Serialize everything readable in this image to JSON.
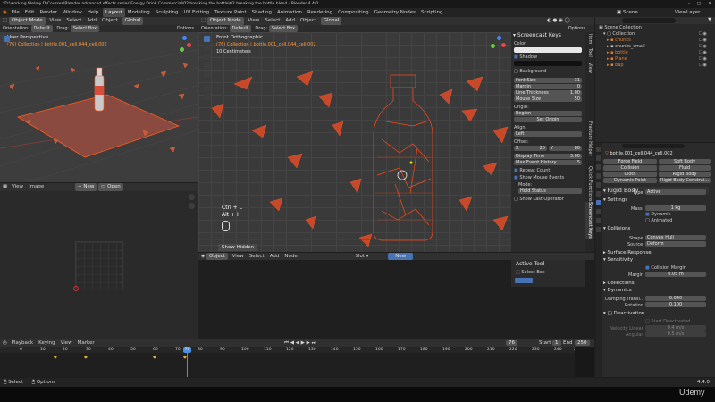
{
  "window": {
    "title": "*D:\\working file\\my D\\Courses\\Blender advanced effects series\\Energy Drink Commercial\\02 breaking the bottle\\02 breaking the bottle.blend - Blender 4.4.0",
    "version": "4.4.0",
    "watermark": "Udemy"
  },
  "topbar": {
    "menus": [
      "File",
      "Edit",
      "Render",
      "Window",
      "Help"
    ],
    "workspaces": [
      "Layout",
      "Modeling",
      "Sculpting",
      "UV Editing",
      "Texture Paint",
      "Shading",
      "Animation",
      "Rendering",
      "Compositing",
      "Geometry Nodes",
      "Scripting"
    ],
    "active_workspace": "Layout",
    "scene": "Scene",
    "view_layer": "ViewLayer"
  },
  "left_viewport": {
    "mode": "Object Mode",
    "menus": [
      "View",
      "Select",
      "Add",
      "Object"
    ],
    "orientation_label": "Orientation:",
    "orientation": "Default",
    "drag_label": "Drag:",
    "drag": "Select Box",
    "options": "Options",
    "transform": "Global",
    "view_name": "User Perspective",
    "collection_line": "(76) Collection | bottle.001_cell.044_cell.002"
  },
  "main_viewport": {
    "mode": "Object Mode",
    "menus": [
      "View",
      "Select",
      "Add",
      "Object"
    ],
    "orientation_label": "Orientation:",
    "orientation": "Default",
    "drag_label": "Drag:",
    "drag": "Select Box",
    "options": "Options",
    "transform": "Global",
    "view_name": "Front Orthographic",
    "collection_line": "(76) Collection | bottle.001_cell.044_cell.002",
    "scale_label": "10 Centimeters",
    "keys_overlay": [
      "Ctrl + L",
      "Alt + H"
    ],
    "last_op": "Show Hidden"
  },
  "screencast_panel": {
    "title": "Screencast Keys",
    "color_label": "Color:",
    "shadow_label": "Shadow",
    "background_label": "Background",
    "font_size_label": "Font Size",
    "font_size": "31",
    "margin_label": "Margin",
    "margin": "0",
    "line_thickness_label": "Line Thickness",
    "line_thickness": "1.00",
    "mouse_size_label": "Mouse Size",
    "mouse_size": "50",
    "origin_label": "Origin:",
    "origin": "Region",
    "set_origin": "Set Origin",
    "align_label": "Align:",
    "align": "Left",
    "offset_label": "Offset:",
    "offset_x_label": "X",
    "offset_x": "20",
    "offset_y_label": "Y",
    "offset_y": "80",
    "display_time_label": "Display Time",
    "display_time": "3.00",
    "max_event_label": "Max Event History",
    "max_event": "5",
    "repeat_count": "Repeat Count",
    "show_mouse": "Show Mouse Events",
    "mode_label": "Mode:",
    "mode": "Hold Status",
    "show_last_op": "Show Last Operator",
    "side_tabs": [
      "Item",
      "Tool",
      "View",
      "Screencast Keys",
      "Fracture Helper",
      "Quick Functions"
    ]
  },
  "image_editor": {
    "menus": [
      "View",
      "Image"
    ],
    "new_label": "New",
    "open_label": "Open"
  },
  "node_editor": {
    "type": "Object",
    "menus": [
      "View",
      "Select",
      "Add",
      "Node"
    ],
    "slot_label": "Slot",
    "new_label": "New",
    "tool_panel_title": "Active Tool",
    "tool_name": "Select Box"
  },
  "outliner": {
    "root": "Scene Collection",
    "items": [
      {
        "name": "Collection",
        "color": "#e0e0e0"
      },
      {
        "name": "chunks",
        "color": "#d8823a"
      },
      {
        "name": "chunks_small",
        "color": "#d8d8d8"
      },
      {
        "name": "bottle",
        "color": "#e07a30"
      },
      {
        "name": "Plane",
        "color": "#e07a30"
      },
      {
        "name": "bap",
        "color": "#d08a3a"
      }
    ]
  },
  "properties": {
    "object_name": "bottle.001_cell.044_cell.002",
    "physics_buttons": [
      {
        "left": "Force Field",
        "right": "Soft Body"
      },
      {
        "left": "Collision",
        "right": "Fluid"
      },
      {
        "left": "Cloth",
        "right": "Rigid Body"
      },
      {
        "left": "Dynamic Paint",
        "right": "Rigid Body Constrai..."
      }
    ],
    "rigid_body_title": "Rigid Body",
    "type_label": "Type",
    "type": "Active",
    "settings": "Settings",
    "mass_label": "Mass",
    "mass": "1 kg",
    "dynamic": "Dynamic",
    "animated": "Animated",
    "collisions": "Collisions",
    "shape_label": "Shape",
    "shape": "Convex Hull",
    "source_label": "Source",
    "source": "Deform",
    "surface_response": "Surface Response",
    "sensitivity": "Sensitivity",
    "collision_margin": "Collision Margin",
    "margin_label": "Margin",
    "margin": "0.05 m",
    "collections": "Collections",
    "dynamics": "Dynamics",
    "damping_translation_label": "Damping Transl...",
    "damping_translation": "0.040",
    "rotation_label": "Rotation",
    "rotation": "0.100",
    "deactivation": "Deactivation",
    "start_deactivated": "Start Deactivated",
    "velocity_linear_label": "Velocity Linear",
    "velocity_linear": "0.4 m/s",
    "angular_label": "Angular",
    "angular": "0.5 m/s"
  },
  "timeline": {
    "menus": [
      "Playback",
      "Keying",
      "View",
      "Marker"
    ],
    "current_frame": "76",
    "start_label": "Start",
    "start": "1",
    "end_label": "End",
    "end": "250",
    "ticks": [
      "0",
      "10",
      "20",
      "30",
      "40",
      "50",
      "60",
      "70",
      "76",
      "80",
      "90",
      "100",
      "110",
      "120",
      "130",
      "140",
      "150",
      "160",
      "170",
      "180",
      "190",
      "200",
      "210",
      "220",
      "230",
      "240",
      "250"
    ]
  },
  "statusbar": {
    "left": "Select",
    "middle": "Options",
    "version": "4.4.0"
  },
  "colors": {
    "accent": "#4772b3",
    "selection": "#ff5a1f",
    "frame": "#4a90e0"
  }
}
